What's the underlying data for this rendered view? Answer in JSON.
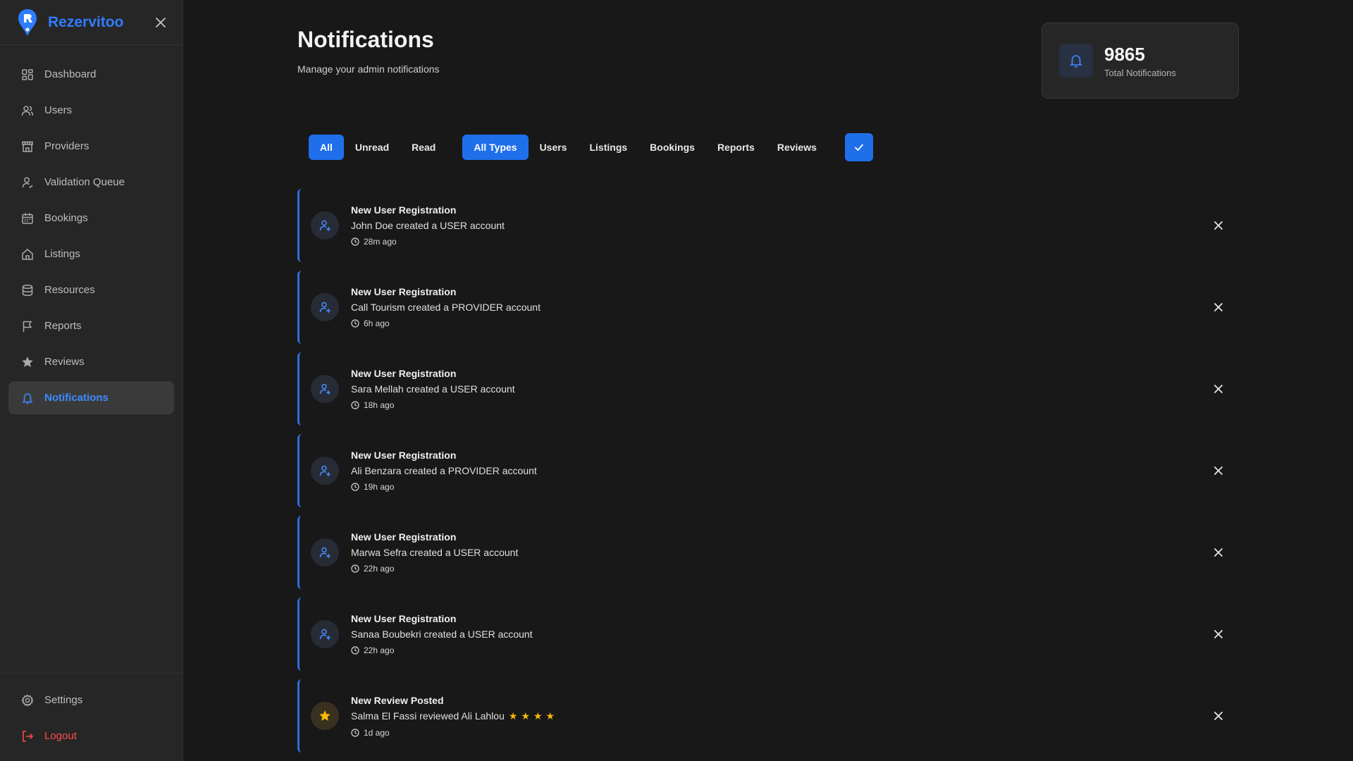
{
  "brand": {
    "name": "Rezervitoo",
    "accent": "#2f7dff"
  },
  "sidebar": {
    "items": [
      {
        "id": "dashboard",
        "label": "Dashboard",
        "icon": "grid-icon"
      },
      {
        "id": "users",
        "label": "Users",
        "icon": "users-icon"
      },
      {
        "id": "providers",
        "label": "Providers",
        "icon": "store-icon"
      },
      {
        "id": "validation-queue",
        "label": "Validation Queue",
        "icon": "user-check-icon"
      },
      {
        "id": "bookings",
        "label": "Bookings",
        "icon": "calendar-icon"
      },
      {
        "id": "listings",
        "label": "Listings",
        "icon": "home-icon"
      },
      {
        "id": "resources",
        "label": "Resources",
        "icon": "database-icon"
      },
      {
        "id": "reports",
        "label": "Reports",
        "icon": "flag-icon"
      },
      {
        "id": "reviews",
        "label": "Reviews",
        "icon": "star-icon"
      },
      {
        "id": "notifications",
        "label": "Notifications",
        "icon": "bell-icon",
        "active": true
      }
    ],
    "bottom": [
      {
        "id": "settings",
        "label": "Settings",
        "icon": "gear-icon"
      },
      {
        "id": "logout",
        "label": "Logout",
        "icon": "logout-icon"
      }
    ]
  },
  "header": {
    "title": "Notifications",
    "subtitle": "Manage your admin notifications"
  },
  "stats": {
    "total_value": "9865",
    "total_label": "Total Notifications"
  },
  "filters": {
    "status": [
      "All",
      "Unread",
      "Read"
    ],
    "types": [
      "All Types",
      "Users",
      "Listings",
      "Bookings",
      "Reports",
      "Reviews"
    ],
    "active_status": "All",
    "active_type": "All Types"
  },
  "notifications": [
    {
      "title": "New User Registration",
      "text": "John Doe created a USER account",
      "time": "28m ago",
      "icon": "user-plus-icon"
    },
    {
      "title": "New User Registration",
      "text": "Call Tourism created a PROVIDER account",
      "time": "6h ago",
      "icon": "user-plus-icon"
    },
    {
      "title": "New User Registration",
      "text": "Sara Mellah created a USER account",
      "time": "18h ago",
      "icon": "user-plus-icon"
    },
    {
      "title": "New User Registration",
      "text": "Ali Benzara created a PROVIDER account",
      "time": "19h ago",
      "icon": "user-plus-icon"
    },
    {
      "title": "New User Registration",
      "text": "Marwa Sefra created a USER account",
      "time": "22h ago",
      "icon": "user-plus-icon"
    },
    {
      "title": "New User Registration",
      "text": "Sanaa Boubekri created a USER account",
      "time": "22h ago",
      "icon": "user-plus-icon"
    },
    {
      "title": "New Review Posted",
      "text": "Salma El Fassi reviewed Ali Lahlou",
      "stars": "★★★★",
      "time": "1d ago",
      "icon": "star-icon"
    }
  ],
  "colors": {
    "background": "#181818",
    "sidebar": "#262626",
    "primary": "#1f6feb",
    "danger": "#ff4d4d",
    "star": "#f5b80b"
  }
}
